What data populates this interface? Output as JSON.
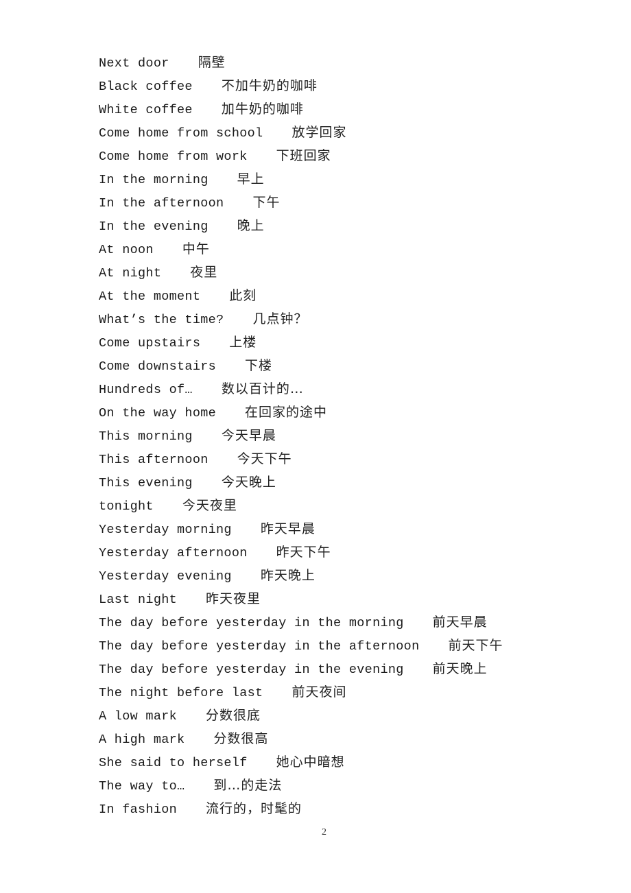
{
  "document": {
    "entries": [
      {
        "english": "Next door",
        "chinese": "隔壁"
      },
      {
        "english": "Black coffee",
        "chinese": "不加牛奶的咖啡"
      },
      {
        "english": "White coffee",
        "chinese": "加牛奶的咖啡"
      },
      {
        "english": "Come home from school",
        "chinese": "放学回家"
      },
      {
        "english": "Come home from work",
        "chinese": "下班回家"
      },
      {
        "english": "In the morning",
        "chinese": "早上"
      },
      {
        "english": "In the afternoon",
        "chinese": "下午"
      },
      {
        "english": "In the evening",
        "chinese": "晚上"
      },
      {
        "english": "At noon",
        "chinese": "中午"
      },
      {
        "english": "At night",
        "chinese": "夜里"
      },
      {
        "english": "At the moment",
        "chinese": "此刻"
      },
      {
        "english": "What’s the time?",
        "chinese": "几点钟？"
      },
      {
        "english": "Come upstairs",
        "chinese": "上楼"
      },
      {
        "english": "Come downstairs",
        "chinese": "下楼"
      },
      {
        "english": "Hundreds of…",
        "chinese": "数以百计的…"
      },
      {
        "english": "On the way home",
        "chinese": "在回家的途中"
      },
      {
        "english": "This morning",
        "chinese": "今天早晨"
      },
      {
        "english": "This afternoon",
        "chinese": "今天下午"
      },
      {
        "english": "This evening",
        "chinese": "今天晚上"
      },
      {
        "english": "tonight",
        "chinese": "今天夜里"
      },
      {
        "english": "Yesterday morning",
        "chinese": "昨天早晨"
      },
      {
        "english": "Yesterday afternoon",
        "chinese": "昨天下午"
      },
      {
        "english": "Yesterday evening",
        "chinese": "昨天晚上"
      },
      {
        "english": "Last night",
        "chinese": "昨天夜里"
      },
      {
        "english": "The day before yesterday in the morning",
        "chinese": "前天早晨"
      },
      {
        "english": "The day before yesterday in the afternoon",
        "chinese": "前天下午"
      },
      {
        "english": "The day before yesterday in the evening",
        "chinese": "前天晚上"
      },
      {
        "english": "The night before last",
        "chinese": "前天夜间"
      },
      {
        "english": "A low mark",
        "chinese": "分数很底"
      },
      {
        "english": "A high mark",
        "chinese": "分数很高"
      },
      {
        "english": "She said to herself",
        "chinese": "她心中暗想"
      },
      {
        "english": "The way to…",
        "chinese": "到…的走法"
      },
      {
        "english": "In fashion",
        "chinese": "流行的，时髦的"
      }
    ],
    "page_number": "2"
  }
}
